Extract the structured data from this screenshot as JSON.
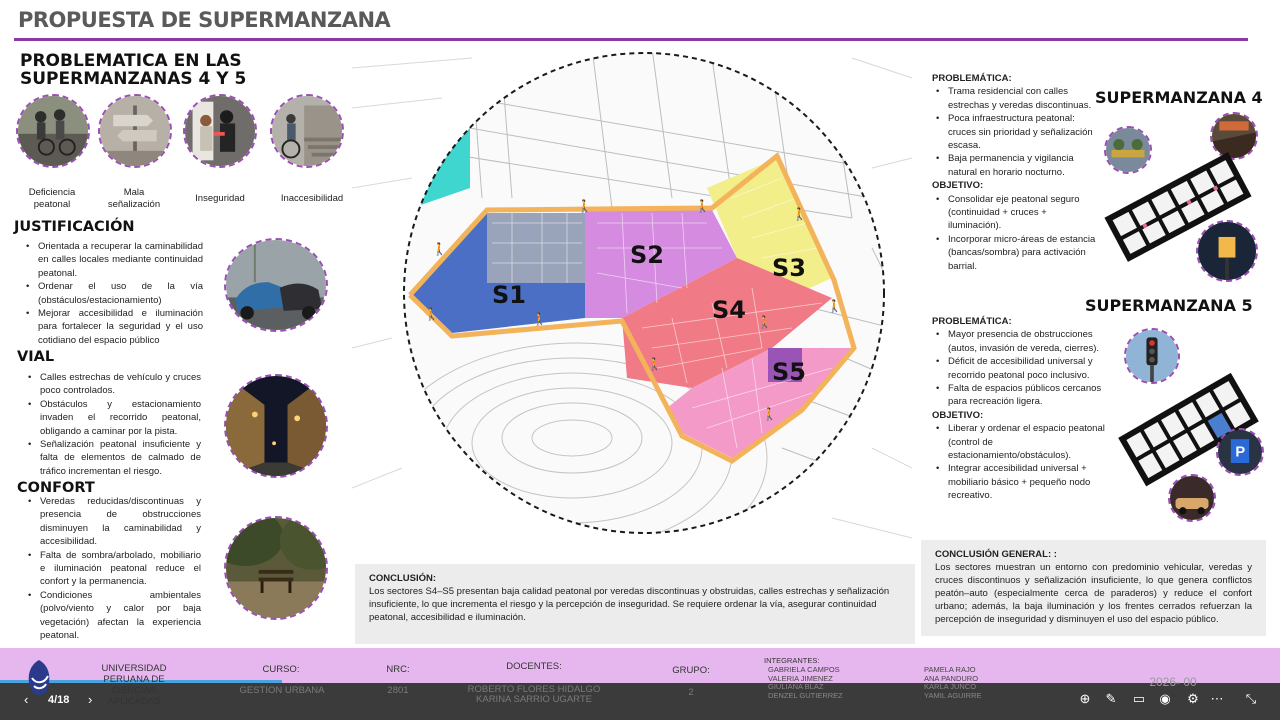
{
  "title": "PROPUESTA DE SUPERMANZANA",
  "problem": {
    "heading": "PROBLEMATICA EN LAS SUPERMANZANAS 4 Y 5",
    "items": [
      {
        "label": "Deficiencia peatonal"
      },
      {
        "label": "Mala señalización"
      },
      {
        "label": "Inseguridad"
      },
      {
        "label": "Inaccesibilidad"
      }
    ]
  },
  "justificacion": {
    "heading": "JUSTIFICACIÓN",
    "bullets": [
      "Orientada a recuperar la caminabilidad en calles locales mediante continuidad peatonal.",
      "Ordenar el uso de la vía (obstáculos/estacionamiento)",
      "Mejorar accesibilidad e iluminación para fortalecer la seguridad y el uso cotidiano del espacio público"
    ]
  },
  "vial": {
    "heading": "VIAL",
    "bullets": [
      "Calles estrechas de vehículo y cruces poco controlados.",
      "Obstáculos y estacionamiento invaden el recorrido peatonal, obligando a caminar por la pista.",
      "Señalización peatonal insuficiente y falta de elementos de calmado de tráfico incrementan el riesgo."
    ]
  },
  "confort": {
    "heading": "CONFORT",
    "bullets": [
      "Veredas reducidas/discontinuas y presencia de obstrucciones disminuyen la caminabilidad y accesibilidad.",
      "Falta de sombra/arbolado, mobiliario e iluminación peatonal reduce el confort y la permanencia.",
      "Condiciones ambientales (polvo/viento y calor por baja vegetación) afectan la experiencia peatonal."
    ]
  },
  "map": {
    "sectors": [
      "S1",
      "S2",
      "S3",
      "S4",
      "S5"
    ],
    "colors": {
      "s1": "#4a6fc4",
      "s2": "#d58be0",
      "s3": "#f2ee8a",
      "s4": "#f07a86",
      "s5": "#f39ac8",
      "border": "#f3b35a",
      "park": "#3fd6d0"
    }
  },
  "conclusion": {
    "title": "CONCLUSIÓN:",
    "text": "Los sectores S4–S5 presentan baja calidad peatonal por veredas discontinuas y obstruidas, calles estrechas y señalización insuficiente, lo que incrementa el riesgo y la percepción de inseguridad. Se requiere ordenar la vía, asegurar continuidad peatonal, accesibilidad e iluminación."
  },
  "sm4": {
    "heading": "SUPERMANZANA 4",
    "problem_label": "PROBLEMÁTICA:",
    "problems": [
      "Trama residencial con calles estrechas y veredas discontinuas.",
      "Poca infraestructura peatonal: cruces sin prioridad y señalización escasa.",
      "Baja permanencia y vigilancia natural en horario nocturno."
    ],
    "objective_label": "OBJETIVO:",
    "objectives": [
      "Consolidar eje peatonal seguro (continuidad + cruces + iluminación).",
      "Incorporar micro-áreas de estancia (bancas/sombra) para activación barrial."
    ]
  },
  "sm5": {
    "heading": "SUPERMANZANA 5",
    "problem_label": "PROBLEMÁTICA:",
    "problems": [
      "Mayor presencia de obstrucciones (autos, invasión de vereda, cierres).",
      "Déficit de accesibilidad universal y recorrido peatonal poco inclusivo.",
      "Falta de espacios públicos cercanos para recreación ligera."
    ],
    "objective_label": "OBJETIVO:",
    "objectives": [
      "Liberar y ordenar el espacio peatonal (control de estacionamiento/obstáculos).",
      "Integrar accesibilidad universal + mobiliario básico + pequeño nodo recreativo."
    ]
  },
  "general_conclusion": {
    "title": "CONCLUSIÓN GENERAL: :",
    "text": "Los sectores muestran un entorno con predominio vehicular, veredas y cruces discontinuos y señalización insuficiente, lo que genera conflictos peatón–auto (especialmente cerca de paraderos) y reduce el confort urbano; además, la baja iluminación y los frentes cerrados refuerzan la percepción de inseguridad y disminuyen el uso del espacio público."
  },
  "footer": {
    "university": "UNIVERSIDAD PERUANA DE CIENCIAS APLICADAS",
    "curso_label": "CURSO:",
    "curso_value": "GESTION URBANA",
    "nrc_label": "NRC:",
    "nrc_value": "2801",
    "docentes_label": "DOCENTES:",
    "docente1": "ROBERTO FLORES HIDALGO",
    "docente2": "KARINA SARRIO UGARTE",
    "grupo_label": "GRUPO:",
    "grupo_value": "2",
    "integrantes_label": "INTEGRANTES:",
    "integrantes_col1": [
      "GABRIELA CAMPOS",
      "VALERIA JIMENEZ",
      "GIULIANA BLAZ",
      "DENZEL GUTIERREZ"
    ],
    "integrantes_col2": [
      "PAMELA RAJO",
      "ANA PANDURO",
      "KARLA JUNCO",
      "YAMIL AGUIRRE"
    ],
    "year": "2026- 00"
  },
  "viewer": {
    "page_indicator": "4/18",
    "progress_fraction": 0.22
  }
}
